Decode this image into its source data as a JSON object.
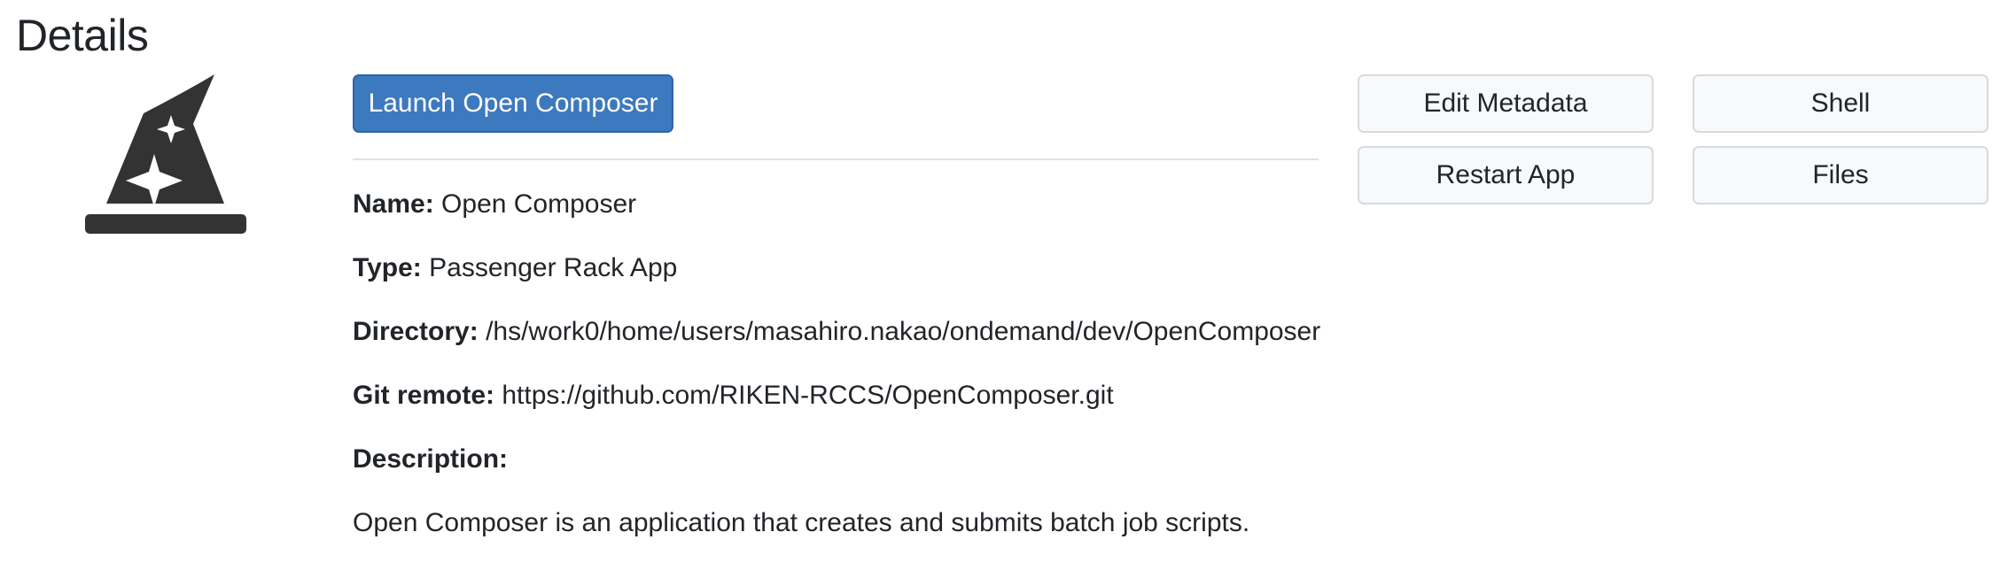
{
  "page": {
    "title": "Details"
  },
  "app_icon": {
    "name": "wizard-hat-icon",
    "color": "#333333"
  },
  "actions": {
    "launch_label": "Launch Open Composer",
    "edit_metadata_label": "Edit Metadata",
    "shell_label": "Shell",
    "restart_label": "Restart App",
    "files_label": "Files",
    "primary_color": "#3d79be"
  },
  "details": {
    "name_label": "Name:",
    "name_value": "Open Composer",
    "type_label": "Type:",
    "type_value": "Passenger Rack App",
    "directory_label": "Directory:",
    "directory_value": "/hs/work0/home/users/masahiro.nakao/ondemand/dev/OpenComposer",
    "git_label": "Git remote:",
    "git_value": "https://github.com/RIKEN-RCCS/OpenComposer.git",
    "description_label": "Description:",
    "description_value": "Open Composer is an application that creates and submits batch job scripts."
  }
}
